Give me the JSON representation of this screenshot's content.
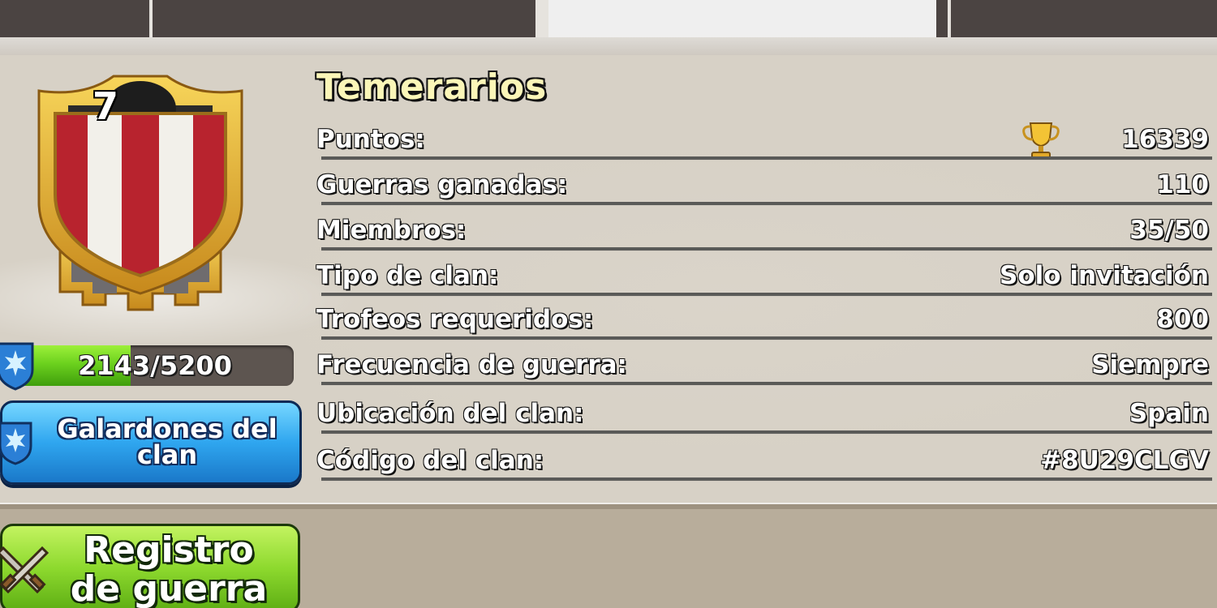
{
  "clan": {
    "name": "Temerarios",
    "level": "7",
    "xp": {
      "text": "2143/5200",
      "current": 2143,
      "max": 5200
    }
  },
  "buttons": {
    "awards_label": "Galardones del clan",
    "war_log_line1": "Registro",
    "war_log_line2": "de guerra"
  },
  "stats": [
    {
      "label": "Puntos:",
      "value": "16339",
      "icon": "trophy-icon"
    },
    {
      "label": "Guerras ganadas:",
      "value": "110"
    },
    {
      "label": "Miembros:",
      "value": "35/50"
    },
    {
      "label": "Tipo de clan:",
      "value": "Solo invitación"
    },
    {
      "label": "Trofeos requeridos:",
      "value": "800"
    },
    {
      "label": "Frecuencia de guerra:",
      "value": "Siempre"
    },
    {
      "label": "Ubicación del clan:",
      "value": "Spain"
    },
    {
      "label": "Código del clan:",
      "value": "#8U29CLGV"
    }
  ],
  "colors": {
    "badge_red": "#b8232e",
    "badge_white": "#f2f0ea",
    "badge_gold": "#e6b63b",
    "xp_green": "#6cd11e",
    "awards_blue": "#2fa6ef",
    "war_green": "#8dd92e",
    "title_yellow": "#fbf6b8"
  },
  "icons": [
    "trophy-icon",
    "xp-star-icon",
    "awards-star-icon",
    "crossed-swords-icon",
    "clan-badge-icon"
  ]
}
